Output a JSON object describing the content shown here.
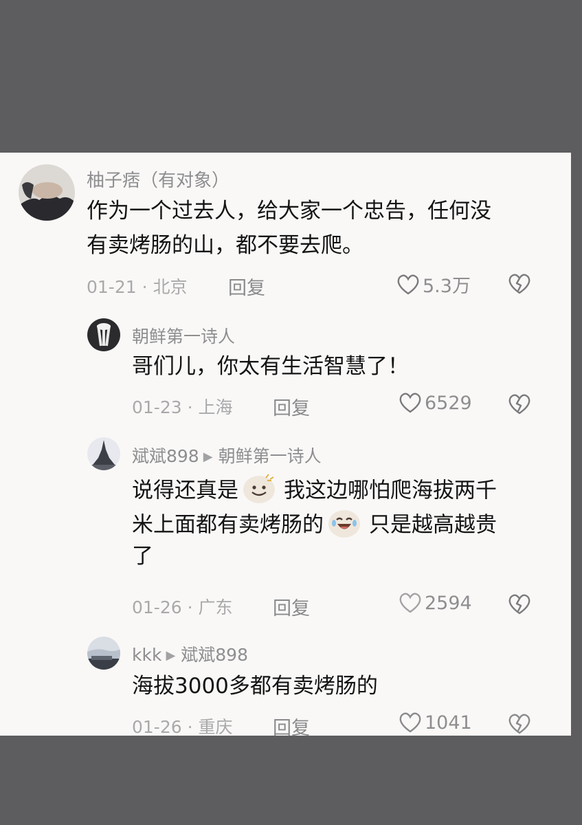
{
  "comments": [
    {
      "user": "柚子痞（有对象）",
      "text_lines": [
        "作为一个过去人，给大家一个忠告，任何没",
        "有卖烤肠的山，都不要去爬。"
      ],
      "meta": "01-21 · 北京",
      "reply_label": "回复",
      "likes": "5.3万"
    },
    {
      "user": "朝鲜第一诗人",
      "text_lines": [
        "哥们儿，你太有生活智慧了！"
      ],
      "meta": "01-23 · 上海",
      "reply_label": "回复",
      "likes": "6529"
    },
    {
      "user": "斌斌898",
      "reply_to": "朝鲜第一诗人",
      "text_parts": [
        "说得还真是",
        "我这边哪怕爬海拔两千",
        "米上面都有卖烤肠的",
        "只是越高越贵",
        "了"
      ],
      "meta": "01-26 · 广东",
      "reply_label": "回复",
      "likes": "2594"
    },
    {
      "user": "kkk",
      "reply_to": "斌斌898",
      "text_lines": [
        "海拔3000多都有卖烤肠的"
      ],
      "meta": "01-26 · 重庆",
      "reply_label": "回复",
      "likes": "1041"
    }
  ],
  "icons": {
    "like": "heart-outline-icon",
    "dislike": "broken-heart-icon",
    "emoji_smile": "smile-emoji-icon",
    "emoji_laugh": "laugh-emoji-icon",
    "reply_arrow": "reply-arrow-icon"
  }
}
